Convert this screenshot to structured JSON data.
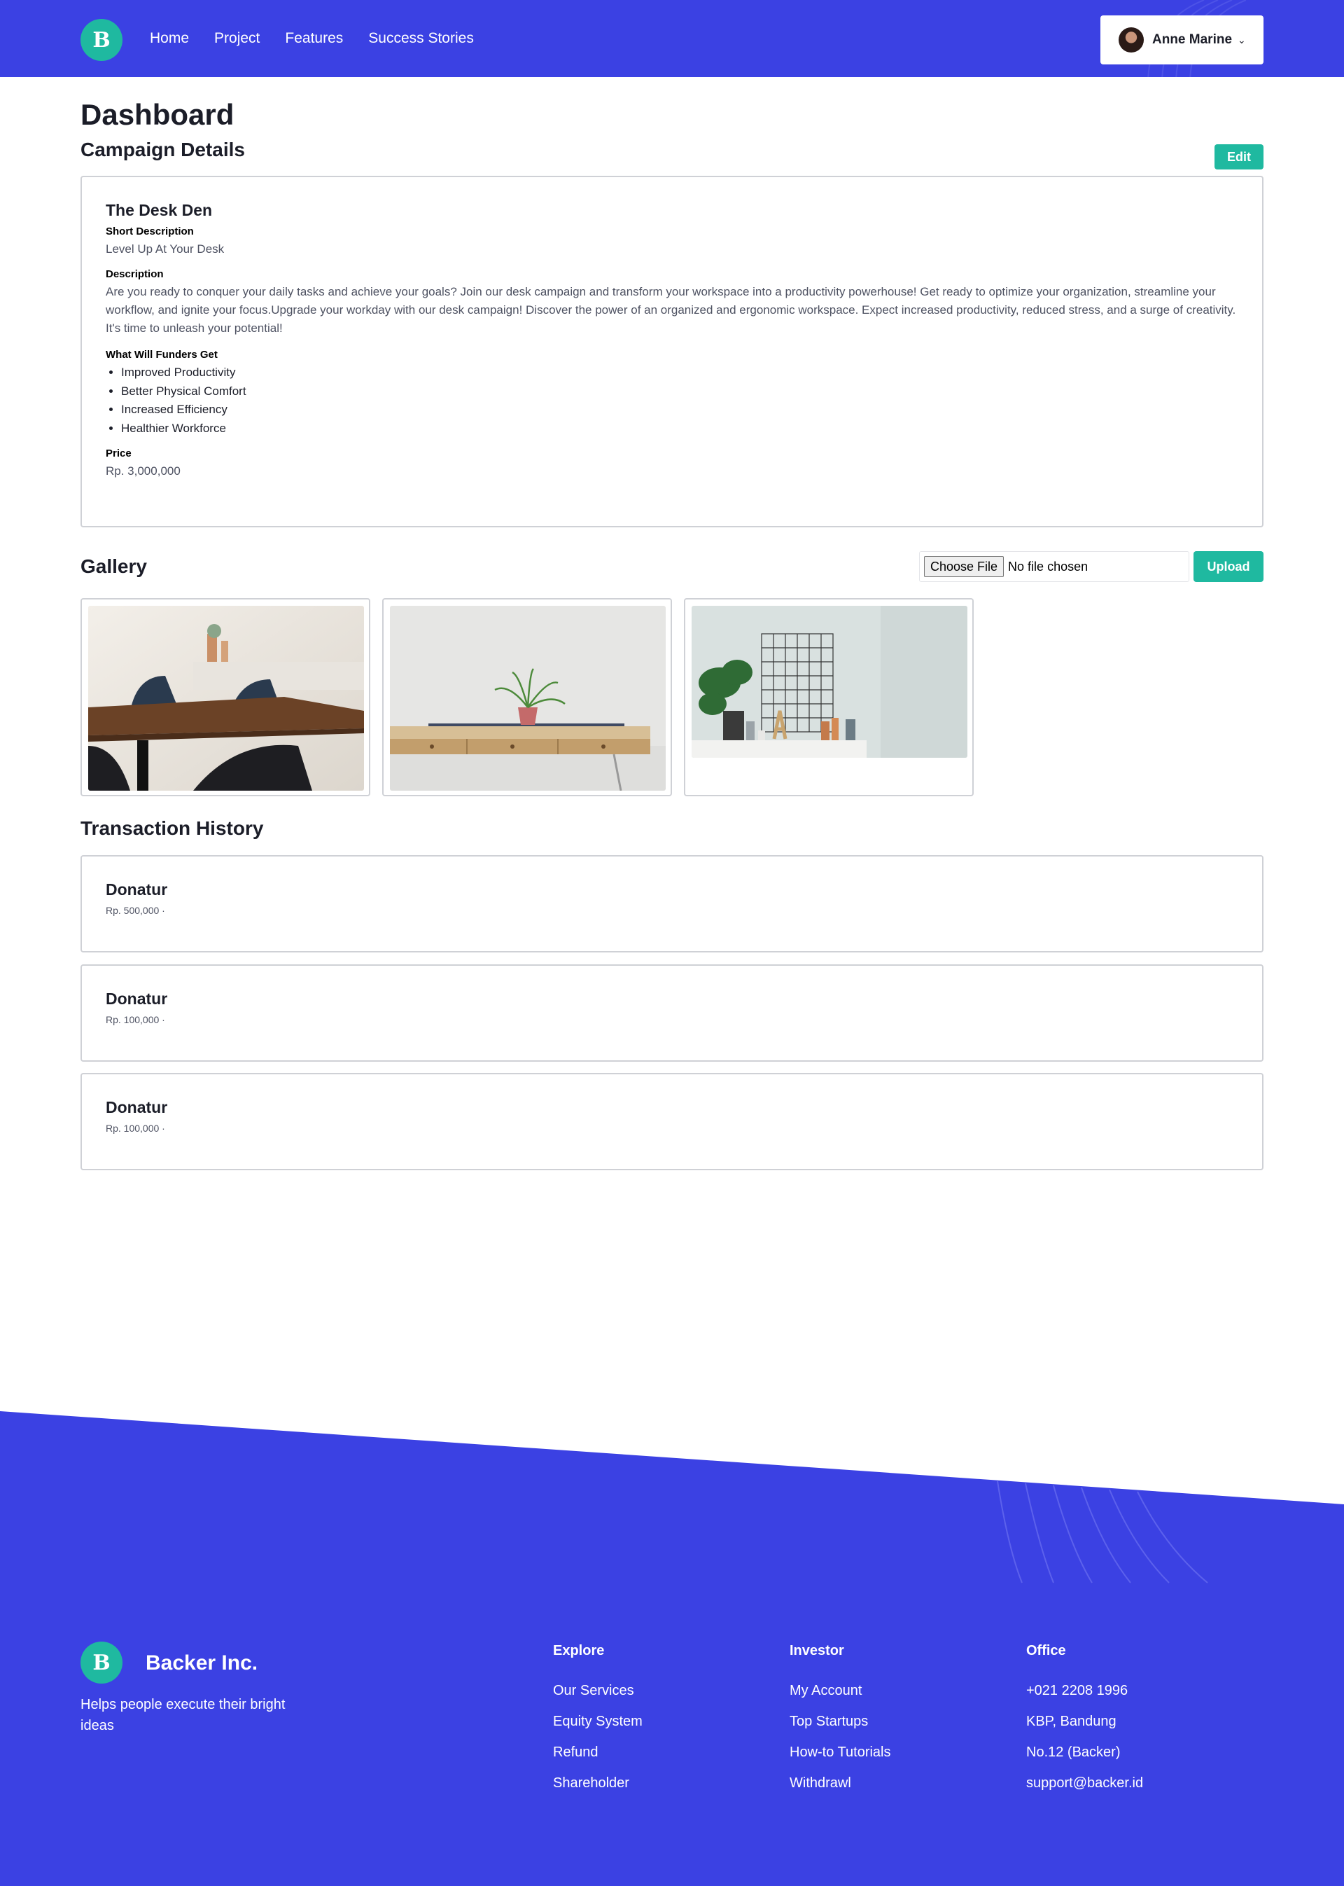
{
  "navbar": {
    "logo_letter": "B",
    "links": [
      "Home",
      "Project",
      "Features",
      "Success Stories"
    ],
    "user_name": "Anne Marine",
    "dropdown_icon": "chevron-down-icon"
  },
  "main": {
    "page_title": "Dashboard",
    "campaign_section_title": "Campaign Details",
    "edit_label": "Edit",
    "campaign": {
      "name": "The Desk Den",
      "short_desc_label": "Short Description",
      "short_desc": "Level Up At Your Desk",
      "desc_label": "Description",
      "desc": "Are you ready to conquer your daily tasks and achieve your goals? Join our desk campaign and transform your workspace into a productivity powerhouse! Get ready to optimize your organization, streamline your workflow, and ignite your focus.Upgrade your workday with our desk campaign! Discover the power of an organized and ergonomic workspace. Expect increased productivity, reduced stress, and a surge of creativity. It's time to unleash your potential!",
      "perks_label": "What Will Funders Get",
      "perks": [
        "Improved Productivity",
        "Better Physical Comfort",
        "Increased Efficiency",
        "Healthier Workforce"
      ],
      "price_label": "Price",
      "price": "Rp. 3,000,000"
    },
    "gallery": {
      "title": "Gallery",
      "file_button": "Choose File",
      "file_status": "No file chosen",
      "upload_label": "Upload"
    },
    "transactions": {
      "title": "Transaction History",
      "items": [
        {
          "name": "Donatur",
          "amount": "Rp. 500,000 ·"
        },
        {
          "name": "Donatur",
          "amount": "Rp. 100,000 ·"
        },
        {
          "name": "Donatur",
          "amount": "Rp. 100,000 ·"
        }
      ]
    }
  },
  "footer": {
    "logo_letter": "B",
    "brand": "Backer Inc.",
    "tagline": "Helps people execute their bright ideas",
    "columns": [
      {
        "heading": "Explore",
        "items": [
          "Our Services",
          "Equity System",
          "Refund",
          "Shareholder"
        ]
      },
      {
        "heading": "Investor",
        "items": [
          "My Account",
          "Top Startups",
          "How-to Tutorials",
          "Withdrawl"
        ]
      },
      {
        "heading": "Office",
        "items": [
          "+021 2208 1996",
          "KBP, Bandung",
          "No.12 (Backer)",
          "support@backer.id"
        ]
      }
    ]
  },
  "colors": {
    "brand_blue": "#3b41e3",
    "accent_teal": "#1fb9a0",
    "text_dark": "#1b1d28",
    "text_muted": "#4e5262",
    "border": "#cfd1d6"
  }
}
